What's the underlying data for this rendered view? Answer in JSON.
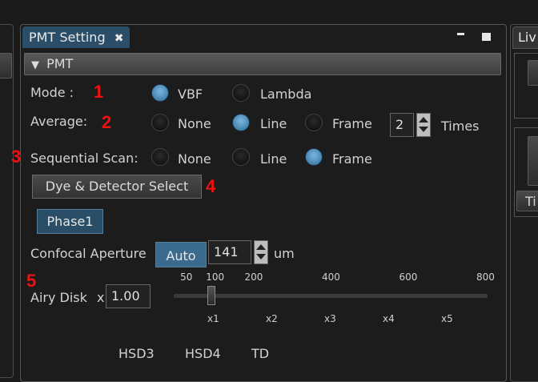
{
  "tab": {
    "title": "PMT Setting",
    "close": "✖"
  },
  "right_tab": {
    "title": "Liv",
    "button": "Ti"
  },
  "section": {
    "title": "PMT"
  },
  "mode": {
    "label": "Mode :",
    "marker": "1",
    "options": [
      "VBF",
      "Lambda"
    ],
    "selected": "VBF"
  },
  "average": {
    "label": "Average:",
    "marker": "2",
    "options": [
      "None",
      "Line",
      "Frame"
    ],
    "selected": "Line",
    "times_value": "2",
    "times_label": "Times"
  },
  "sequential": {
    "label": "Sequential Scan:",
    "marker": "3",
    "options": [
      "None",
      "Line",
      "Frame"
    ],
    "selected": "Frame"
  },
  "dye_button": {
    "label": "Dye & Detector Select",
    "marker": "4"
  },
  "phase_button": {
    "label": "Phase1"
  },
  "aperture": {
    "label": "Confocal Aperture",
    "auto_label": "Auto",
    "value": "141",
    "unit": "um"
  },
  "airy": {
    "marker": "5",
    "label": "Airy Disk",
    "multiplier": "x",
    "value": "1.00",
    "slider_value": 141,
    "top_ticks": [
      {
        "label": "50",
        "value": 50
      },
      {
        "label": "100",
        "value": 100
      },
      {
        "label": "200",
        "value": 200
      },
      {
        "label": "400",
        "value": 400
      },
      {
        "label": "600",
        "value": 600
      },
      {
        "label": "800",
        "value": 800
      }
    ],
    "bottom_ticks": [
      "x1",
      "x2",
      "x3",
      "x4",
      "x5"
    ]
  },
  "detectors": [
    "HSD3",
    "HSD4",
    "TD"
  ]
}
